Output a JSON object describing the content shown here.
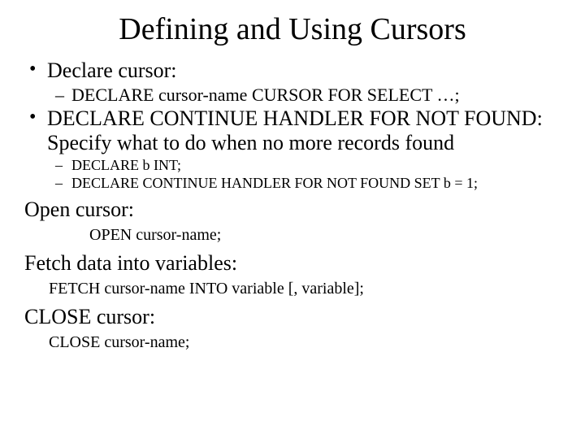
{
  "title": "Defining and Using Cursors",
  "items": {
    "declare_cursor": "Declare cursor:",
    "declare_cursor_syntax": "DECLARE cursor-name CURSOR FOR SELECT …;",
    "continue_handler": "DECLARE  CONTINUE HANDLER FOR NOT FOUND: Specify what to do when no more records found",
    "declare_b_int": "DECLARE  b INT;",
    "declare_handler_set": "DECLARE CONTINUE HANDLER FOR NOT FOUND SET b = 1;",
    "open_cursor": "Open cursor:",
    "open_cursor_syntax": "OPEN cursor-name;",
    "fetch": "Fetch data into variables:",
    "fetch_syntax": "FETCH cursor-name INTO variable [, variable];",
    "close": "CLOSE cursor:",
    "close_syntax": "CLOSE cursor-name;"
  }
}
